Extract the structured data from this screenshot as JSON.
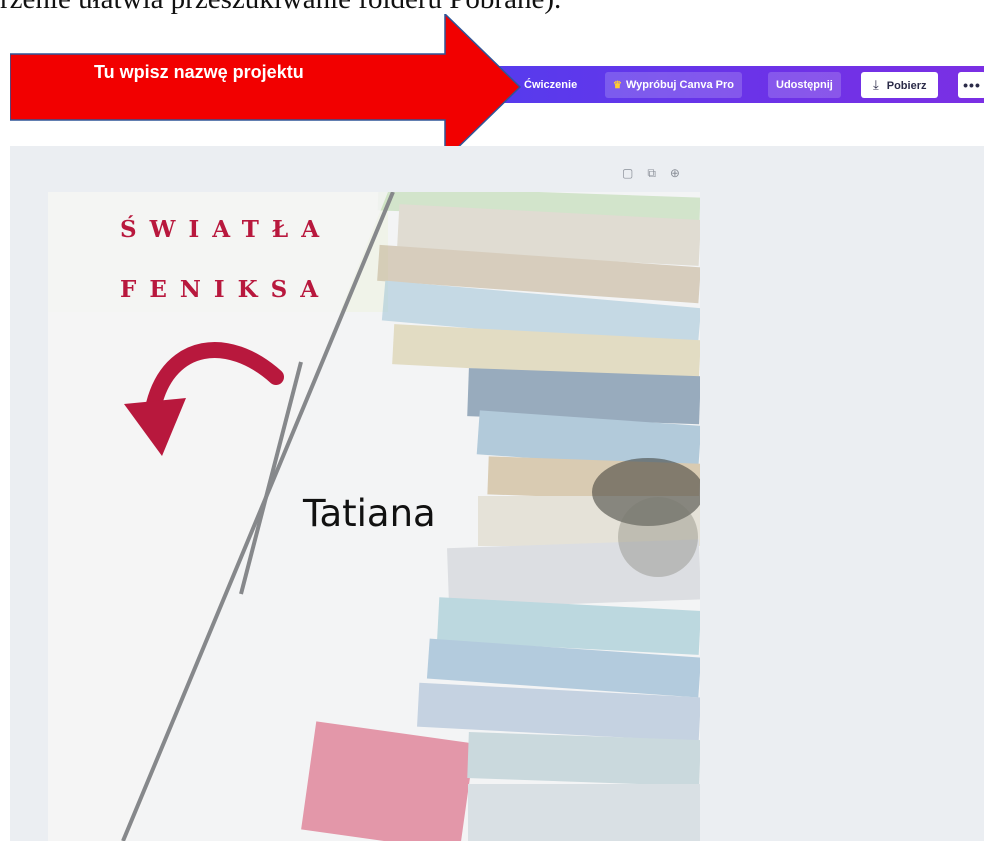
{
  "document": {
    "top_line": "rzenie ułatwia przeszukiwanie folderu Pobrane)."
  },
  "annotation": {
    "text": "Tu wpisz nazwę projektu",
    "color": "#f20000"
  },
  "toolbar": {
    "project_name": "Ćwiczenie",
    "try_pro_label": "Wypróbuj Canva Pro",
    "share_label": "Udostępnij",
    "download_label": "Pobierz",
    "more_label": "•••",
    "crown_icon": "crown-icon",
    "download_icon": "download-icon"
  },
  "page_tools": {
    "note_icon": "note-icon",
    "duplicate_icon": "duplicate-page-icon",
    "add_page_icon": "add-page-icon"
  },
  "design": {
    "title_line_1": "ŚWIATŁA",
    "title_line_2": "FENIKSA",
    "author_name": "Tatiana",
    "accent_color": "#b8183d",
    "background_image": "stack-of-books-photo"
  }
}
